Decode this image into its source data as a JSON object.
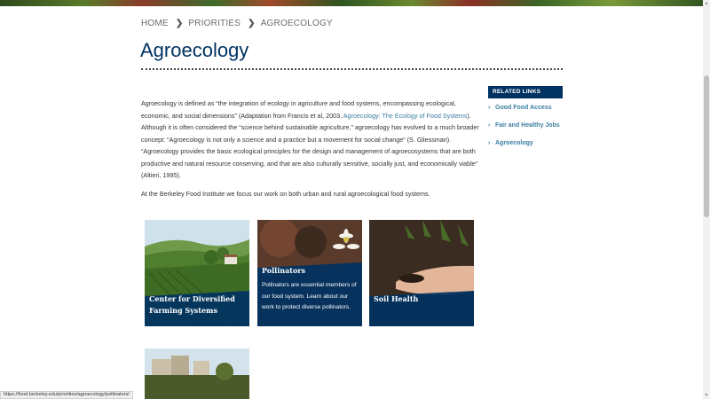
{
  "breadcrumb": {
    "home": "HOME",
    "priorities": "PRIORITIES",
    "current": "AGROECOLOGY"
  },
  "page": {
    "title": "Agroecology"
  },
  "content": {
    "p1_before_link": "Agroecology is defined as “the integration of ecology in agriculture and food systems, encompassing ecological, economic, and social dimensions” (Adaptation from Francis et al, 2003, ",
    "p1_link": "Agroecology: The Ecology of Food Systems",
    "p1_after_link": "). Although it is often considered the “science behind sustainable agriculture,” agroecology has evolved to a much broader concept: “Agroecology is not only a science and a practice but a movement for social change” (S. Gliessman). “Agroecology provides the basic ecological principles for the design and management of agroecosystems that are both productive and natural resource conserving, and that are also culturally sensitive, socially just, and economically viable” (Altieri, 1995).",
    "p2": "At the Berkeley Food Institute we focus our work on both urban and rural agroecological food systems."
  },
  "related_links": {
    "heading": "RELATED LINKS",
    "items": [
      {
        "label": "Good Food Access"
      },
      {
        "label": "Fair and Healthy Jobs"
      },
      {
        "label": "Agroecology"
      }
    ]
  },
  "cards": [
    {
      "title_line1": "Center for Diversified",
      "title_line2": "Farming Systems"
    },
    {
      "title": "Pollinators",
      "desc_line1": "Pollinators are essential members of",
      "desc_line2": "our food system. Learn about our",
      "desc_line3": "work to protect diverse pollinators."
    },
    {
      "title": "Soil Health"
    }
  ],
  "status_bar": {
    "url": "https://food.berkeley.edu/priorities/agroecology/pollinators/"
  },
  "colors": {
    "brand_navy": "#003262",
    "link_blue": "#3b7ea1"
  }
}
